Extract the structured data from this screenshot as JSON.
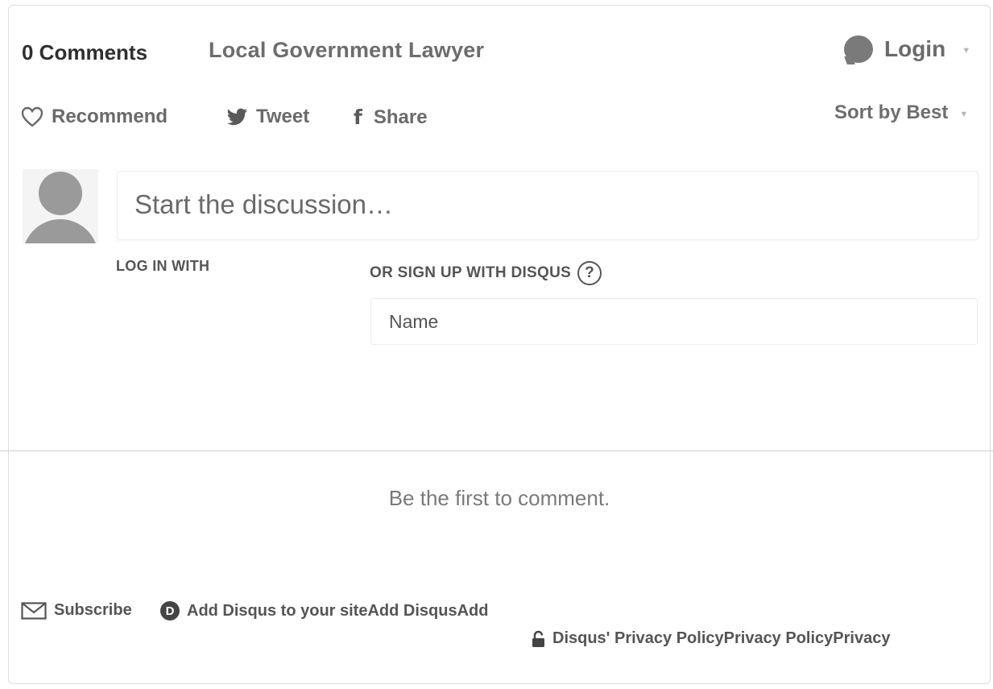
{
  "header": {
    "comment_count": "0 Comments",
    "forum_name": "Local Government Lawyer",
    "login_label": "Login"
  },
  "actions": {
    "recommend": "Recommend",
    "tweet": "Tweet",
    "share": "Share",
    "sort": "Sort by Best"
  },
  "composer": {
    "placeholder": "Start the discussion…"
  },
  "auth": {
    "log_in_with": "LOG IN WITH",
    "sign_up_with": "OR SIGN UP WITH DISQUS",
    "help_glyph": "?",
    "name_placeholder": "Name"
  },
  "empty_state": {
    "message": "Be the first to comment."
  },
  "footer": {
    "subscribe": "Subscribe",
    "add_disqus": "Add Disqus to your siteAdd DisqusAdd",
    "privacy": "Disqus' Privacy PolicyPrivacy PolicyPrivacy",
    "disqus_logo_letter": "D"
  },
  "icons": {
    "login": "chat-bubble-icon",
    "recommend": "heart-icon",
    "tweet": "twitter-bird-icon",
    "share": "facebook-f-icon",
    "subscribe": "envelope-icon",
    "add_disqus": "disqus-logo-icon",
    "privacy": "lock-icon",
    "help": "question-circle-icon",
    "dropdown": "chevron-down-icon"
  },
  "colors": {
    "text_dark": "#2f2f2f",
    "text_muted": "#6a6a6a",
    "avatar_gray": "#9a9a9a",
    "border": "#ececec"
  }
}
